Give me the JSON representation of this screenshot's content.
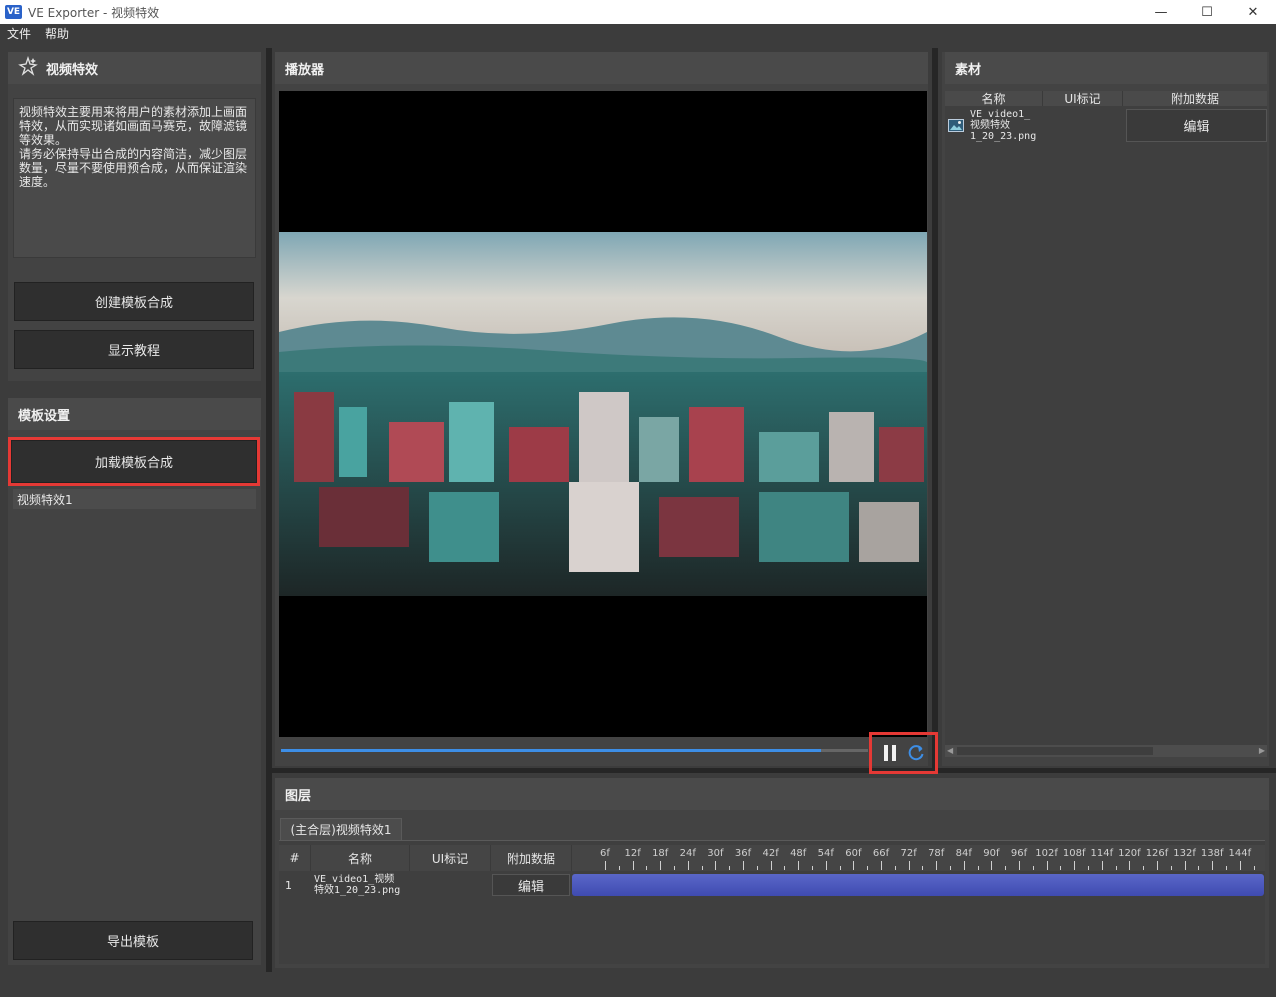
{
  "window": {
    "logo_text": "VE",
    "title": "VE Exporter - 视频特效",
    "minimize": "—",
    "maximize": "☐",
    "close": "✕"
  },
  "menu": {
    "items": [
      "文件",
      "帮助"
    ]
  },
  "effects_panel": {
    "title": "视频特效",
    "icon": "sparkle-icon",
    "description": "视频特效主要用来将用户的素材添加上画面特效，从而实现诸如画面马赛克，故障滤镜等效果。\n请务必保持导出合成的内容简洁，减少图层数量，尽量不要使用预合成，从而保证渲染速度。",
    "create_button": "创建模板合成",
    "tutorial_button": "显示教程"
  },
  "template_settings": {
    "title": "模板设置",
    "load_button": "加载模板合成",
    "items": [
      "视频特效1"
    ],
    "export_button": "导出模板"
  },
  "player": {
    "title": "播放器",
    "progress": 0.92,
    "pause_icon": "pause-icon",
    "replay_icon": "replay-icon"
  },
  "materials": {
    "title": "素材",
    "columns": [
      "名称",
      "UI标记",
      "附加数据"
    ],
    "rows": [
      {
        "name": "VE_video1_\n视频特效\n1_20_23.png",
        "ui_mark": "",
        "edit_label": "编辑",
        "icon": "image-icon"
      }
    ]
  },
  "layers": {
    "title": "图层",
    "tab_label": "(主合层)视频特效1",
    "columns": [
      "#",
      "名称",
      "UI标记",
      "附加数据"
    ],
    "rows": [
      {
        "index": "1",
        "name": "VE_video1_视频\n特效1_20_23.png",
        "ui_mark": "",
        "edit_label": "编辑"
      }
    ],
    "timeline_ticks": [
      "6f",
      "12f",
      "18f",
      "24f",
      "30f",
      "36f",
      "42f",
      "48f",
      "54f",
      "60f",
      "66f",
      "72f",
      "78f",
      "84f",
      "90f",
      "96f",
      "102f",
      "108f",
      "114f",
      "120f",
      "126f",
      "132f",
      "138f",
      "144f"
    ]
  },
  "colors": {
    "highlight": "#e53935",
    "progress": "#3d8ee6",
    "track": "#4a56bd"
  }
}
